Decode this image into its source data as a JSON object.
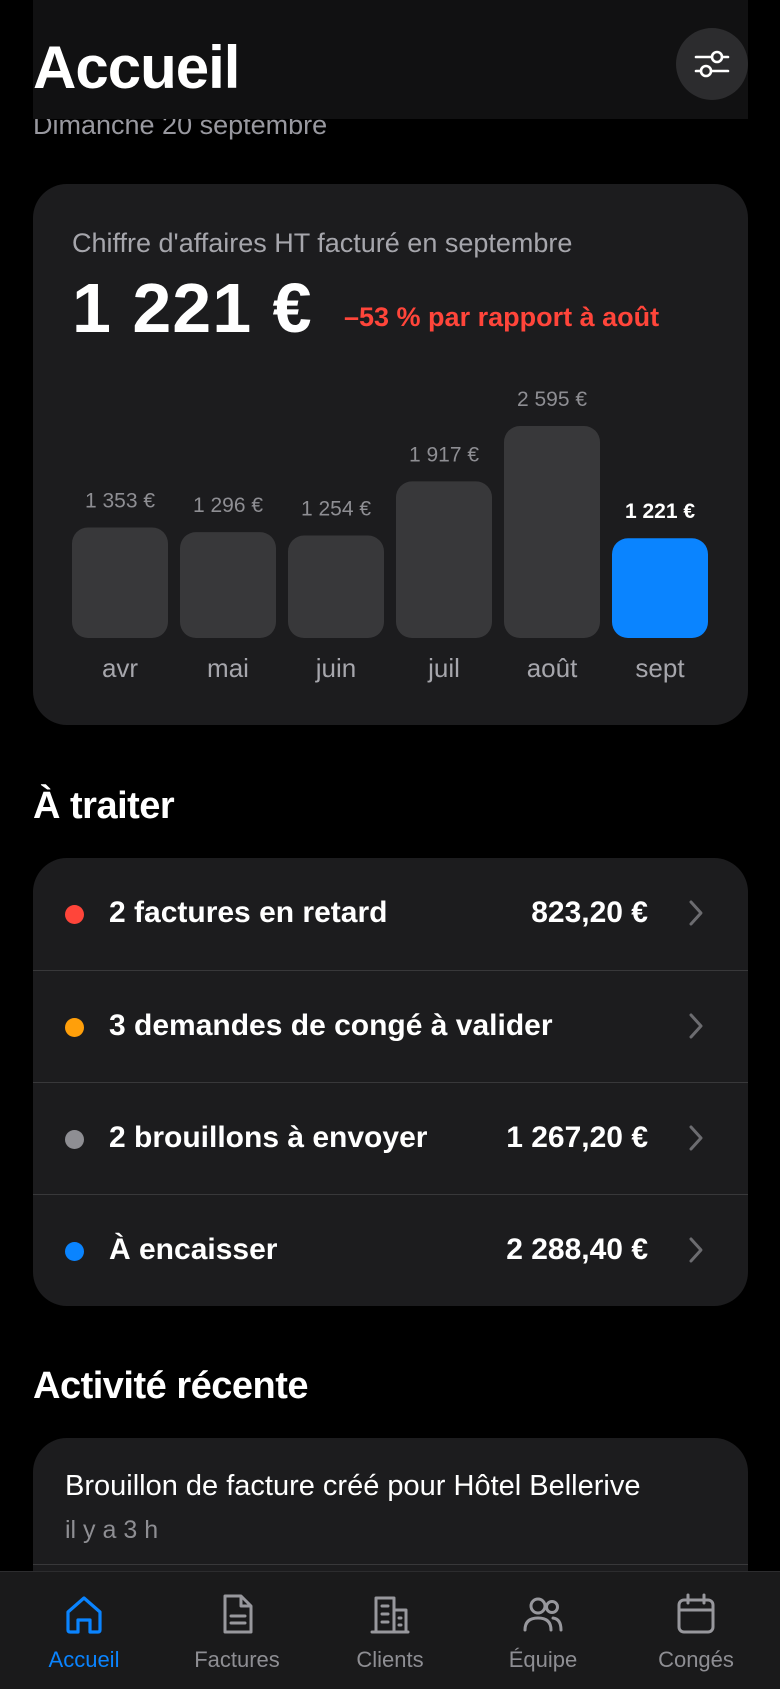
{
  "header": {
    "title": "Accueil",
    "date": "Dimanche 20 septembre",
    "filter_icon": "sliders-icon"
  },
  "revenue": {
    "label": "Chiffre d'affaires HT facturé en septembre",
    "amount": "1 221 €",
    "change": "–53 % par rapport à août",
    "change_color": "#ff453a"
  },
  "chart_data": {
    "type": "bar",
    "categories": [
      "avr",
      "mai",
      "juin",
      "juil",
      "août",
      "sept"
    ],
    "values": [
      1353,
      1296,
      1254,
      1917,
      2595,
      1221
    ],
    "value_labels": [
      "1 353 €",
      "1 296 €",
      "1 254 €",
      "1 917 €",
      "2 595 €",
      "1 221 €"
    ],
    "highlight_index": 5,
    "bar_color": "#38383a",
    "highlight_color": "#0a84ff"
  },
  "todo": {
    "title": "À traiter",
    "items": [
      {
        "label": "2 factures en retard",
        "amount": "823,20 €",
        "dot_color": "#ff453a"
      },
      {
        "label": "3 demandes de congé à valider",
        "amount": "",
        "dot_color": "#ff9f0a"
      },
      {
        "label": "2 brouillons à envoyer",
        "amount": "1 267,20 €",
        "dot_color": "#8e8e93"
      },
      {
        "label": "À encaisser",
        "amount": "2 288,40 €",
        "dot_color": "#0a84ff"
      }
    ]
  },
  "activity": {
    "title": "Activité récente",
    "items": [
      {
        "text": "Brouillon de facture créé pour Hôtel Bellerive",
        "time": "il y a 3 h"
      }
    ]
  },
  "tabs": [
    {
      "label": "Accueil",
      "icon": "home-icon",
      "active": true
    },
    {
      "label": "Factures",
      "icon": "document-icon",
      "active": false
    },
    {
      "label": "Clients",
      "icon": "building-icon",
      "active": false
    },
    {
      "label": "Équipe",
      "icon": "people-icon",
      "active": false
    },
    {
      "label": "Congés",
      "icon": "calendar-icon",
      "active": false
    }
  ],
  "colors": {
    "accent": "#0a84ff",
    "background": "#000000",
    "card": "#1c1c1e"
  }
}
